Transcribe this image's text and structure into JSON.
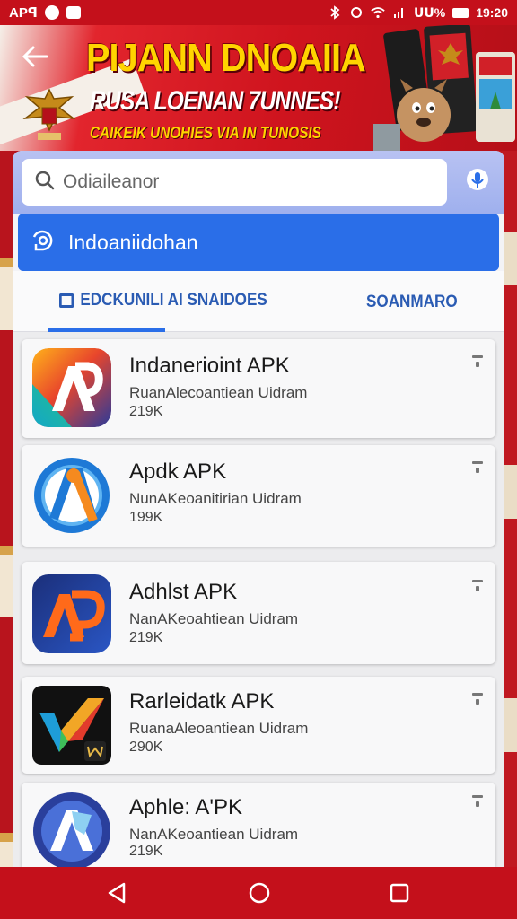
{
  "status_bar": {
    "carrier": "APꟼ",
    "battery": "ᑌᑌ%",
    "time": "19:20"
  },
  "banner": {
    "title": "PIJANN DNOAIIA",
    "subtitle": "RUSA LOENAN 7UNNES!",
    "tagline": "CAIKEIK UNOHIES VIA IN TUNOSIS"
  },
  "search": {
    "placeholder": "Odiaileanor"
  },
  "suggestion": {
    "label": "Indoaniidohan"
  },
  "tabs": [
    {
      "label": "EDCKUNILI AI SNAIDOES"
    },
    {
      "label": "SOANMARO"
    }
  ],
  "apps": [
    {
      "name": "Indanerioint APK",
      "desc": "RuanAlecoantiean Uidram",
      "size": "219K",
      "icon": "ap-gradient-icon"
    },
    {
      "name": "Apdk APK",
      "desc": "NunAKeoanitirian Uidram",
      "size": "199K",
      "icon": "a-compass-icon"
    },
    {
      "name": "Adhlst APK",
      "desc": "NanAKeoahtiean Uidram",
      "size": "219K",
      "icon": "ap-orange-icon"
    },
    {
      "name": "Rarleidatk APK",
      "desc": "RuanaAleoantiean Uidram",
      "size": "290K",
      "icon": "v-check-icon"
    },
    {
      "name": "Aphle: A'PK",
      "desc": "NanAKeoantiean Uidram",
      "size": "219K",
      "icon": "a-shield-icon"
    }
  ],
  "nav": {
    "back": "back-icon",
    "home": "home-icon",
    "recents": "recents-icon"
  },
  "colors": {
    "brand_red": "#c4101b",
    "accent_blue": "#2a6ee8",
    "banner_yellow": "#ffd400"
  }
}
